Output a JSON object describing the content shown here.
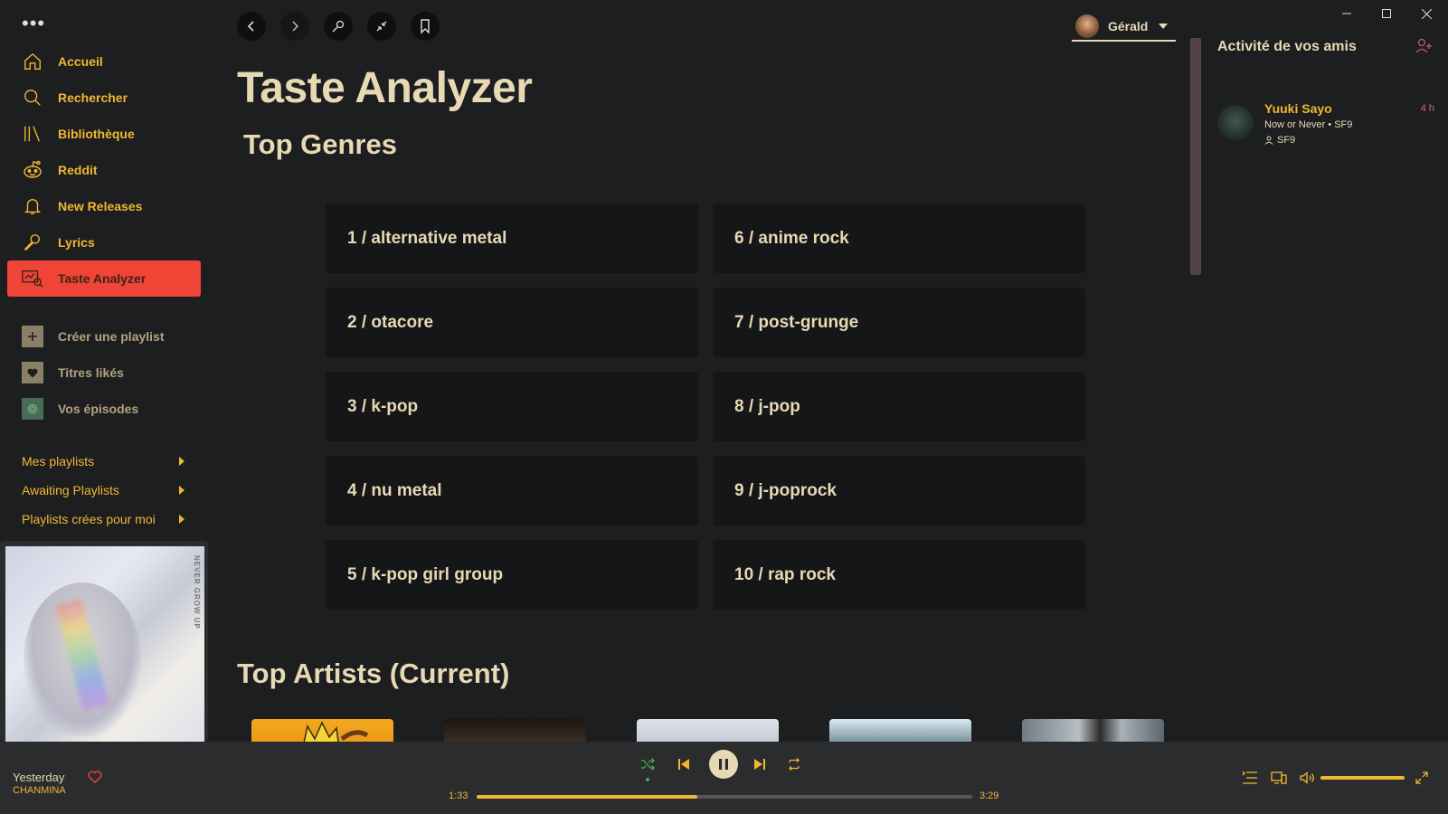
{
  "sidebar": {
    "menu_dots": "•••",
    "nav": [
      {
        "label": "Accueil",
        "icon": "home-icon"
      },
      {
        "label": "Rechercher",
        "icon": "search-icon"
      },
      {
        "label": "Bibliothèque",
        "icon": "library-icon"
      },
      {
        "label": "Reddit",
        "icon": "reddit-icon"
      },
      {
        "label": "New Releases",
        "icon": "bell-icon"
      },
      {
        "label": "Lyrics",
        "icon": "microphone-icon"
      },
      {
        "label": "Taste Analyzer",
        "icon": "analyzer-icon",
        "active": true
      }
    ],
    "library": [
      {
        "label": "Créer une playlist",
        "icon": "plus-icon"
      },
      {
        "label": "Titres likés",
        "icon": "heart-icon"
      },
      {
        "label": "Vos épisodes",
        "icon": "podcast-icon"
      }
    ],
    "playlists": [
      {
        "label": "Mes playlists"
      },
      {
        "label": "Awaiting Playlists"
      },
      {
        "label": "Playlists crées pour moi"
      }
    ],
    "cover_text": "NEVER GROW UP"
  },
  "topbar": {
    "user_name": "Gérald"
  },
  "main": {
    "title": "Taste Analyzer",
    "genres_title": "Top Genres",
    "genres": [
      "1 / alternative metal",
      "2 / otacore",
      "3 / k-pop",
      "4 / nu metal",
      "5 / k-pop girl group",
      "6 / anime rock",
      "7 / post-grunge",
      "8 / j-pop",
      "9 / j-poprock",
      "10 / rap rock"
    ],
    "artists_title": "Top Artists (Current)"
  },
  "friends": {
    "title": "Activité de vos amis",
    "items": [
      {
        "name": "Yuuki Sayo",
        "song": "Now or Never • SF9",
        "source": "SF9",
        "time": "4 h"
      }
    ]
  },
  "player": {
    "track": "Yesterday",
    "artist": "CHANMINA",
    "current_time": "1:33",
    "total_time": "3:29",
    "progress": 0.445,
    "volume": 1.0
  },
  "colors": {
    "accent": "#f2b731",
    "active": "#f04437",
    "text": "#e8d9b5",
    "background": "#1c1e20"
  }
}
